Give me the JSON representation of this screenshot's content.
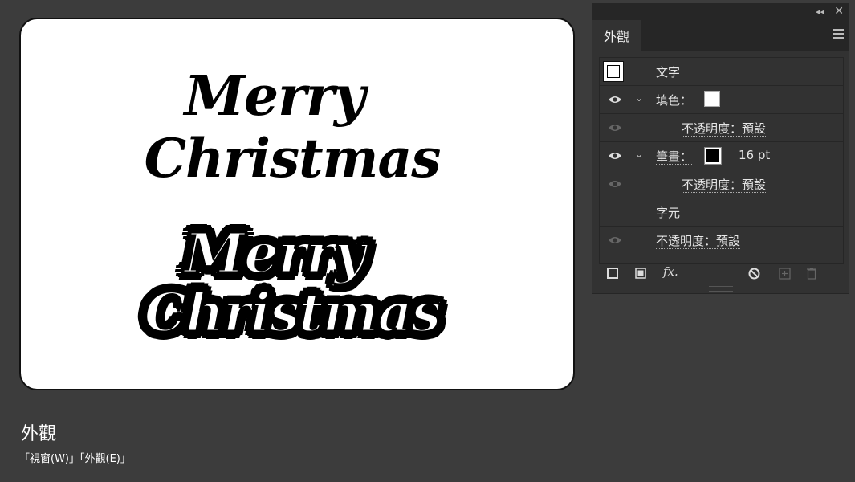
{
  "artboard": {
    "line1": "Merry",
    "line2": "Christmas"
  },
  "caption": {
    "title": "外觀",
    "path": "「視窗(W)」「外觀(E)」"
  },
  "panel": {
    "tab": "外觀",
    "rows": {
      "object": "文字",
      "fill_label": "填色：",
      "fill_opacity": "不透明度：預設",
      "stroke_label": "筆畫：",
      "stroke_width": "16 pt",
      "stroke_opacity": "不透明度：預設",
      "characters": "字元",
      "opacity": "不透明度：預設"
    }
  },
  "colors": {
    "fill": "#ffffff",
    "stroke": "#000000"
  },
  "icons": {
    "collapse": "double-chevron-left-icon",
    "close": "close-icon",
    "menu": "hamburger-menu-icon",
    "visibility": "eye-icon",
    "expand": "chevron-down-icon",
    "add_stroke": "square-outline-icon",
    "add_fill": "square-filled-icon",
    "effects": "fx-icon",
    "clear": "no-sign-icon",
    "duplicate": "plus-square-icon",
    "delete": "trash-icon"
  }
}
